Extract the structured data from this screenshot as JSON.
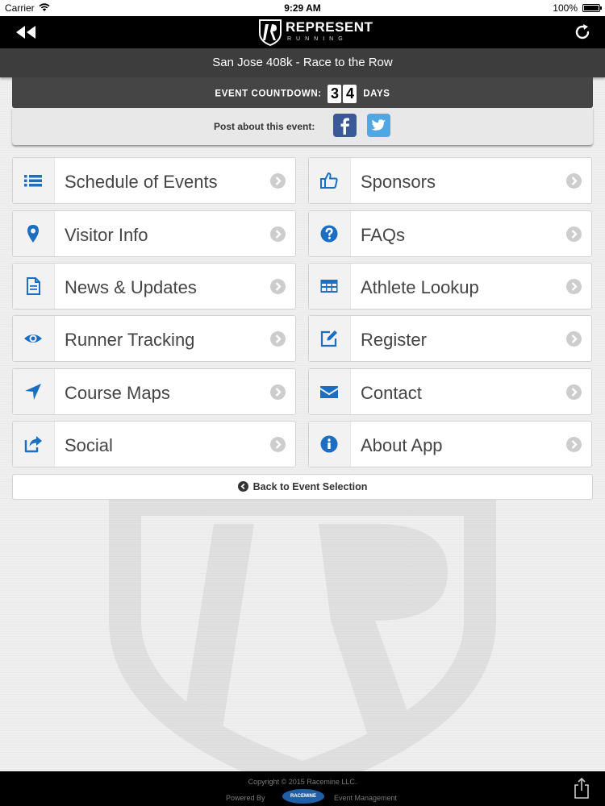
{
  "status_bar": {
    "carrier": "Carrier",
    "time": "9:29 AM",
    "battery": "100%",
    "battery_level": 1.0
  },
  "nav": {
    "logo_text": "REPRESENT",
    "logo_sub": "RUNNING",
    "back_icon": "rewind-icon",
    "refresh_icon": "refresh-icon"
  },
  "event": {
    "title": "San Jose 408k - Race to the Row"
  },
  "countdown": {
    "label": "EVENT COUNTDOWN:",
    "digits": [
      "3",
      "4"
    ],
    "unit": "DAYS"
  },
  "post": {
    "label": "Post about this event:",
    "icons": [
      "facebook-icon",
      "twitter-icon"
    ]
  },
  "menu": {
    "left": [
      {
        "label": "Schedule of Events",
        "icon": "list-icon"
      },
      {
        "label": "Visitor Info",
        "icon": "map-marker-icon"
      },
      {
        "label": "News & Updates",
        "icon": "document-icon"
      },
      {
        "label": "Runner Tracking",
        "icon": "eye-icon"
      },
      {
        "label": "Course Maps",
        "icon": "location-arrow-icon"
      },
      {
        "label": "Social",
        "icon": "share-icon"
      }
    ],
    "right": [
      {
        "label": "Sponsors",
        "icon": "thumbs-up-icon"
      },
      {
        "label": "FAQs",
        "icon": "question-circle-icon"
      },
      {
        "label": "Athlete Lookup",
        "icon": "table-icon"
      },
      {
        "label": "Register",
        "icon": "edit-icon"
      },
      {
        "label": "Contact",
        "icon": "envelope-icon"
      },
      {
        "label": "About App",
        "icon": "info-circle-icon"
      }
    ]
  },
  "back_button": {
    "label": "Back to Event Selection"
  },
  "footer": {
    "copyright": "Copyright © 2015 Racemine LLC.",
    "powered_by": "Powered By",
    "logo_text": "RACEMINE",
    "event_mgmt": "Event Management"
  },
  "colors": {
    "icon_blue": "#1b6fc2",
    "nav_bg": "#000000",
    "title_bar_bg": "#3d3d3d",
    "facebook": "#3b5998",
    "twitter": "#4fa7e3"
  }
}
